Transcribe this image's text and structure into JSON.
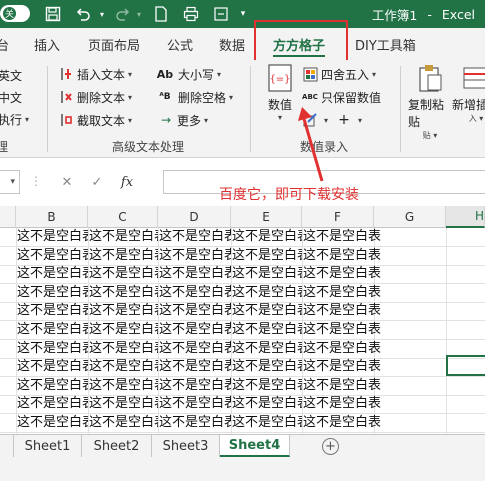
{
  "titlebar": {
    "toggle_label": "关",
    "filename": "工作簿1",
    "separator": "-",
    "app": "Excel"
  },
  "tabs": [
    {
      "label": "台"
    },
    {
      "label": "插入"
    },
    {
      "label": "页面布局"
    },
    {
      "label": "公式"
    },
    {
      "label": "数据"
    },
    {
      "label": "方方格子"
    },
    {
      "label": "DIY工具箱"
    }
  ],
  "ribbon": {
    "left_column": [
      "英文",
      "中文",
      "执行"
    ],
    "advanced_text": {
      "insert_text": "插入文本",
      "delete_text": "删除文本",
      "cut_text": "截取文本",
      "case": "大小写",
      "delete_spaces": "删除空格",
      "more": "更多",
      "group_label": "高级文本处理"
    },
    "number_entry": {
      "value_button": "数值",
      "round": "四舍五入",
      "keep_value": "只保留数值",
      "group_label": "数值录入"
    },
    "copy_paste": "复制粘贴",
    "new_insert": "新增插入"
  },
  "formula_bar": {
    "cancel": "✕",
    "confirm": "✓",
    "fx": "fx"
  },
  "annotation": "百度它，即可下载安装",
  "columns": [
    "B",
    "C",
    "D",
    "E",
    "F",
    "G",
    "H"
  ],
  "cell_text": "这不是空白表",
  "rows": 11,
  "sheets": [
    "Sheet1",
    "Sheet2",
    "Sheet3",
    "Sheet4"
  ],
  "active_sheet": "Sheet4",
  "colors": {
    "brand": "#217346",
    "annotation": "#e03030"
  }
}
